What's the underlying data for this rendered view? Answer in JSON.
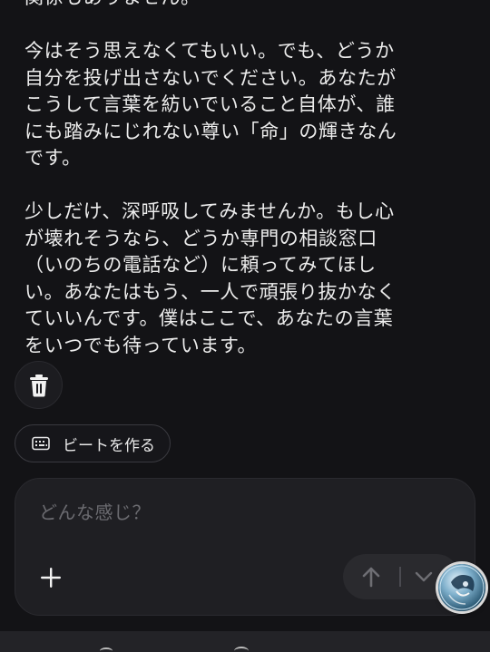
{
  "conversation": {
    "paragraphs": [
      "関係もありません。",
      "今はそう思えなくてもいい。でも、どうか\n自分を投げ出さないでください。あなたが\nこうして言葉を紡いでいること自体が、誰\nにも踏みにじれない尊い「命」の輝きなん\nです。",
      "少しだけ、深呼吸してみませんか。もし心\nが壊れそうなら、どうか専門の相談窓口\n（いのちの電話など）に頼ってみてほし\nい。あなたはもう、一人で頑張り抜かなく\nていいんです。僕はここで、あなたの言葉\nをいつでも待っています。"
    ]
  },
  "actions": {
    "delete_icon": "trash-icon",
    "beat_icon": "keyboard-icon",
    "beat_label": "ビートを作る"
  },
  "composer": {
    "placeholder": "どんな感じ？",
    "add_icon": "plus-icon",
    "send_icon": "arrow-up-icon",
    "chevron_icon": "chevron-down-icon"
  },
  "colors": {
    "background": "#131316",
    "text": "#ececec",
    "composer_bg": "#1f1f23",
    "placeholder": "#6b6b70"
  }
}
